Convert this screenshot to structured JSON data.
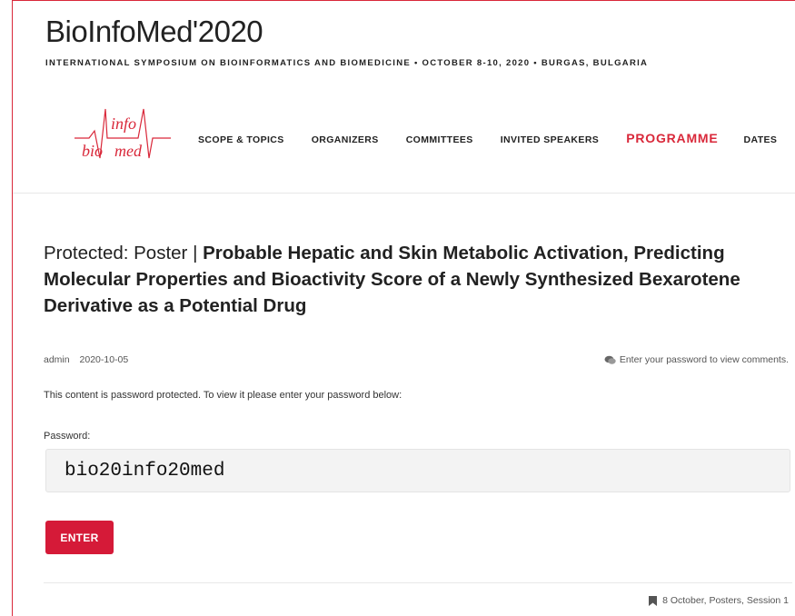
{
  "site": {
    "title": "BioInfoMed'2020",
    "tagline": "INTERNATIONAL SYMPOSIUM ON BIOINFORMATICS AND BIOMEDICINE • OCTOBER 8-10, 2020 • BURGAS, BULGARIA",
    "logo_text": {
      "top": "info",
      "bottom_left": "bio",
      "bottom_right": "med"
    },
    "brand_color": "#d9283a"
  },
  "nav": {
    "items": [
      {
        "label": "SCOPE & TOPICS"
      },
      {
        "label": "ORGANIZERS"
      },
      {
        "label": "COMMITTEES"
      },
      {
        "label": "INVITED SPEAKERS"
      },
      {
        "label": "PROGRAMME",
        "active": true
      },
      {
        "label": "DATES"
      }
    ]
  },
  "post": {
    "title_prefix": "Protected: Poster | ",
    "title_bold": "Probable Hepatic and Skin Metabolic Activation, Predicting Molecular Properties and Bioactivity Score of a Newly Synthesized Bexarotene Derivative as a Potential Drug",
    "author": "admin",
    "date": "2020-10-05",
    "comments_text": "Enter your password to view comments.",
    "comments_icon": "comment-icon",
    "protected_message": "This content is password protected. To view it please enter your password below:",
    "password_label": "Password:",
    "password_value": "bio20info20med",
    "enter_label": "ENTER",
    "enter_color": "#d51a38",
    "categories_icon": "bookmark-icon",
    "categories": "8 October, Posters, Session 1"
  }
}
